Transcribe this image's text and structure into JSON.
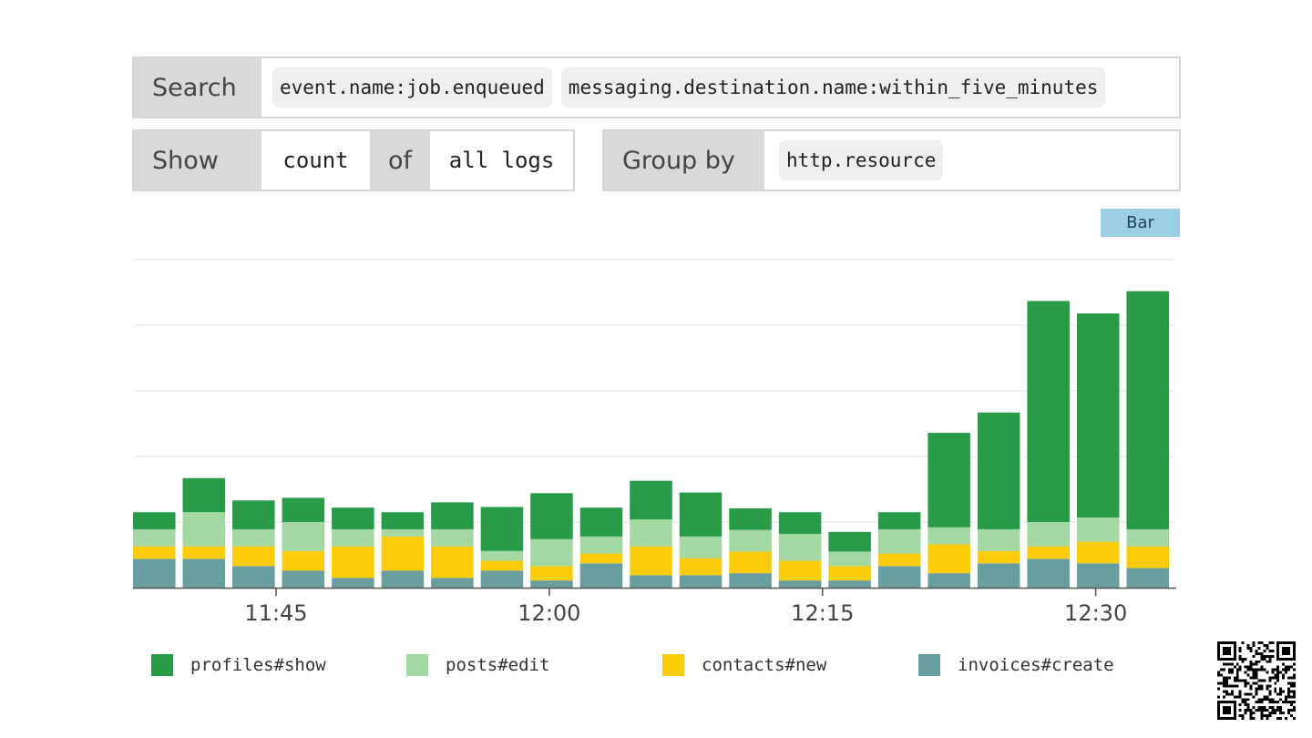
{
  "search": {
    "label": "Search",
    "terms": [
      "event.name:job.enqueued",
      "messaging.destination.name:within_five_minutes"
    ]
  },
  "show": {
    "label": "Show",
    "aggregate": "count",
    "of_label": "of",
    "source": "all logs"
  },
  "group_by": {
    "label": "Group by",
    "field": "http.resource"
  },
  "visualization": {
    "type_label": "Bar"
  },
  "chart_data": {
    "type": "bar",
    "stacked": true,
    "grid": true,
    "x_ticks": [
      "11:45",
      "12:00",
      "12:15",
      "12:30"
    ],
    "ylim": [
      0,
      5
    ],
    "series": [
      {
        "name": "invoices#create",
        "color": "#699e9e",
        "values": [
          0.44,
          0.44,
          0.33,
          0.26,
          0.15,
          0.26,
          0.15,
          0.26,
          0.11,
          0.37,
          0.19,
          0.19,
          0.22,
          0.11,
          0.11,
          0.33,
          0.22,
          0.37,
          0.44,
          0.37,
          0.3
        ]
      },
      {
        "name": "contacts#new",
        "color": "#fccc08",
        "values": [
          0.19,
          0.19,
          0.3,
          0.3,
          0.48,
          0.52,
          0.48,
          0.15,
          0.22,
          0.15,
          0.44,
          0.26,
          0.33,
          0.3,
          0.22,
          0.19,
          0.44,
          0.19,
          0.19,
          0.33,
          0.33
        ]
      },
      {
        "name": "posts#edit",
        "color": "#a3d8a3",
        "values": [
          0.26,
          0.52,
          0.26,
          0.44,
          0.26,
          0.11,
          0.26,
          0.15,
          0.41,
          0.26,
          0.41,
          0.33,
          0.33,
          0.41,
          0.22,
          0.37,
          0.26,
          0.33,
          0.37,
          0.37,
          0.26
        ]
      },
      {
        "name": "profiles#show",
        "color": "#279b48",
        "values": [
          0.26,
          0.52,
          0.44,
          0.37,
          0.33,
          0.26,
          0.41,
          0.67,
          0.7,
          0.44,
          0.59,
          0.67,
          0.33,
          0.33,
          0.3,
          0.26,
          1.44,
          1.78,
          3.37,
          3.11,
          3.63
        ]
      }
    ]
  },
  "legend": [
    {
      "name": "profiles#show",
      "color": "#279b48"
    },
    {
      "name": "posts#edit",
      "color": "#a3d8a3"
    },
    {
      "name": "contacts#new",
      "color": "#fccc08"
    },
    {
      "name": "invoices#create",
      "color": "#699e9e"
    }
  ],
  "qr_icon": "qr-code-icon"
}
